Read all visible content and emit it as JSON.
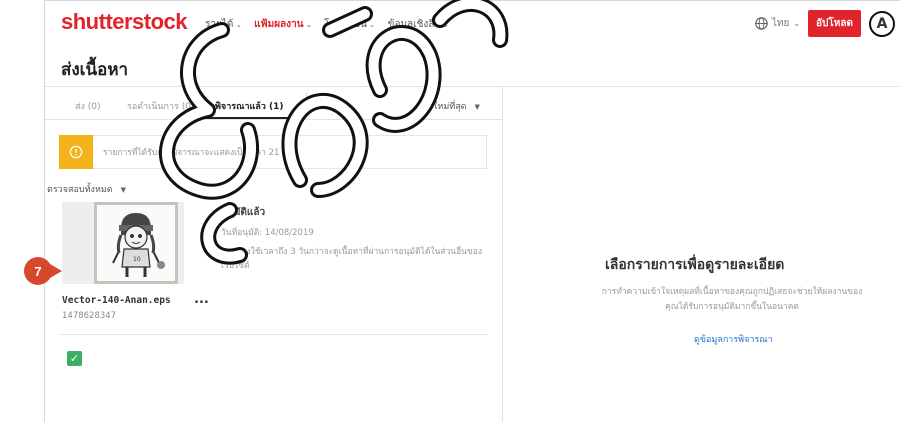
{
  "header": {
    "logo": "shutterstock",
    "nav": [
      {
        "label": "รายได้",
        "active": false
      },
      {
        "label": "แฟ้มผลงาน",
        "active": true
      },
      {
        "label": "โปรโมชัน",
        "active": false
      },
      {
        "label": "ข้อมูลเชิงลึก",
        "active": false
      }
    ],
    "language": "ไทย",
    "upload_label": "อัปโหลด",
    "avatar_letter": "A"
  },
  "page": {
    "title": "ส่งเนื้อหา"
  },
  "tabs": [
    {
      "label": "ส่ง (0)",
      "active": false
    },
    {
      "label": "รอดำเนินการ (0)",
      "active": false
    },
    {
      "label": "พิจารณาแล้ว (1)",
      "active": true
    },
    {
      "label": "ภาพ",
      "active": false
    },
    {
      "label": "ใหม่ที่สุด",
      "active": false
    }
  ],
  "notice": {
    "icon": "!",
    "text": "รายการที่ได้รับการพิจารณาจะแสดงเป็นเวลา 21 วัน"
  },
  "filter_label": "ตรวจสอบทั้งหมด",
  "item": {
    "status": "อนุมัติแล้ว",
    "date": "วันที่อนุมัติ: 14/08/2019",
    "note": "อาจต้องใช้เวลาถึง 3 วันกว่าจะดูเนื้อหาที่ผ่านการอนุมัติได้ในส่วนอื่นของเว็บไซต์",
    "filename": "Vector-140-Anan.eps",
    "id": "1478628347",
    "checked": "✓",
    "more": "..."
  },
  "detail": {
    "title": "เลือกรายการเพื่อดูรายละเอียด",
    "description": "การทำความเข้าใจเหตุผลที่เนื้อหาของคุณถูกปฏิเสธจะช่วยให้ผลงานของคุณได้รับการอนุมัติมากขึ้นในอนาคต",
    "link": "ดูข้อมูลการพิจารณา"
  },
  "step_marker": "7",
  "colors": {
    "brand": "#e2232c",
    "notice": "#f5b21a",
    "check": "#3cae66",
    "link": "#1a73c9",
    "step": "#d9482c"
  }
}
